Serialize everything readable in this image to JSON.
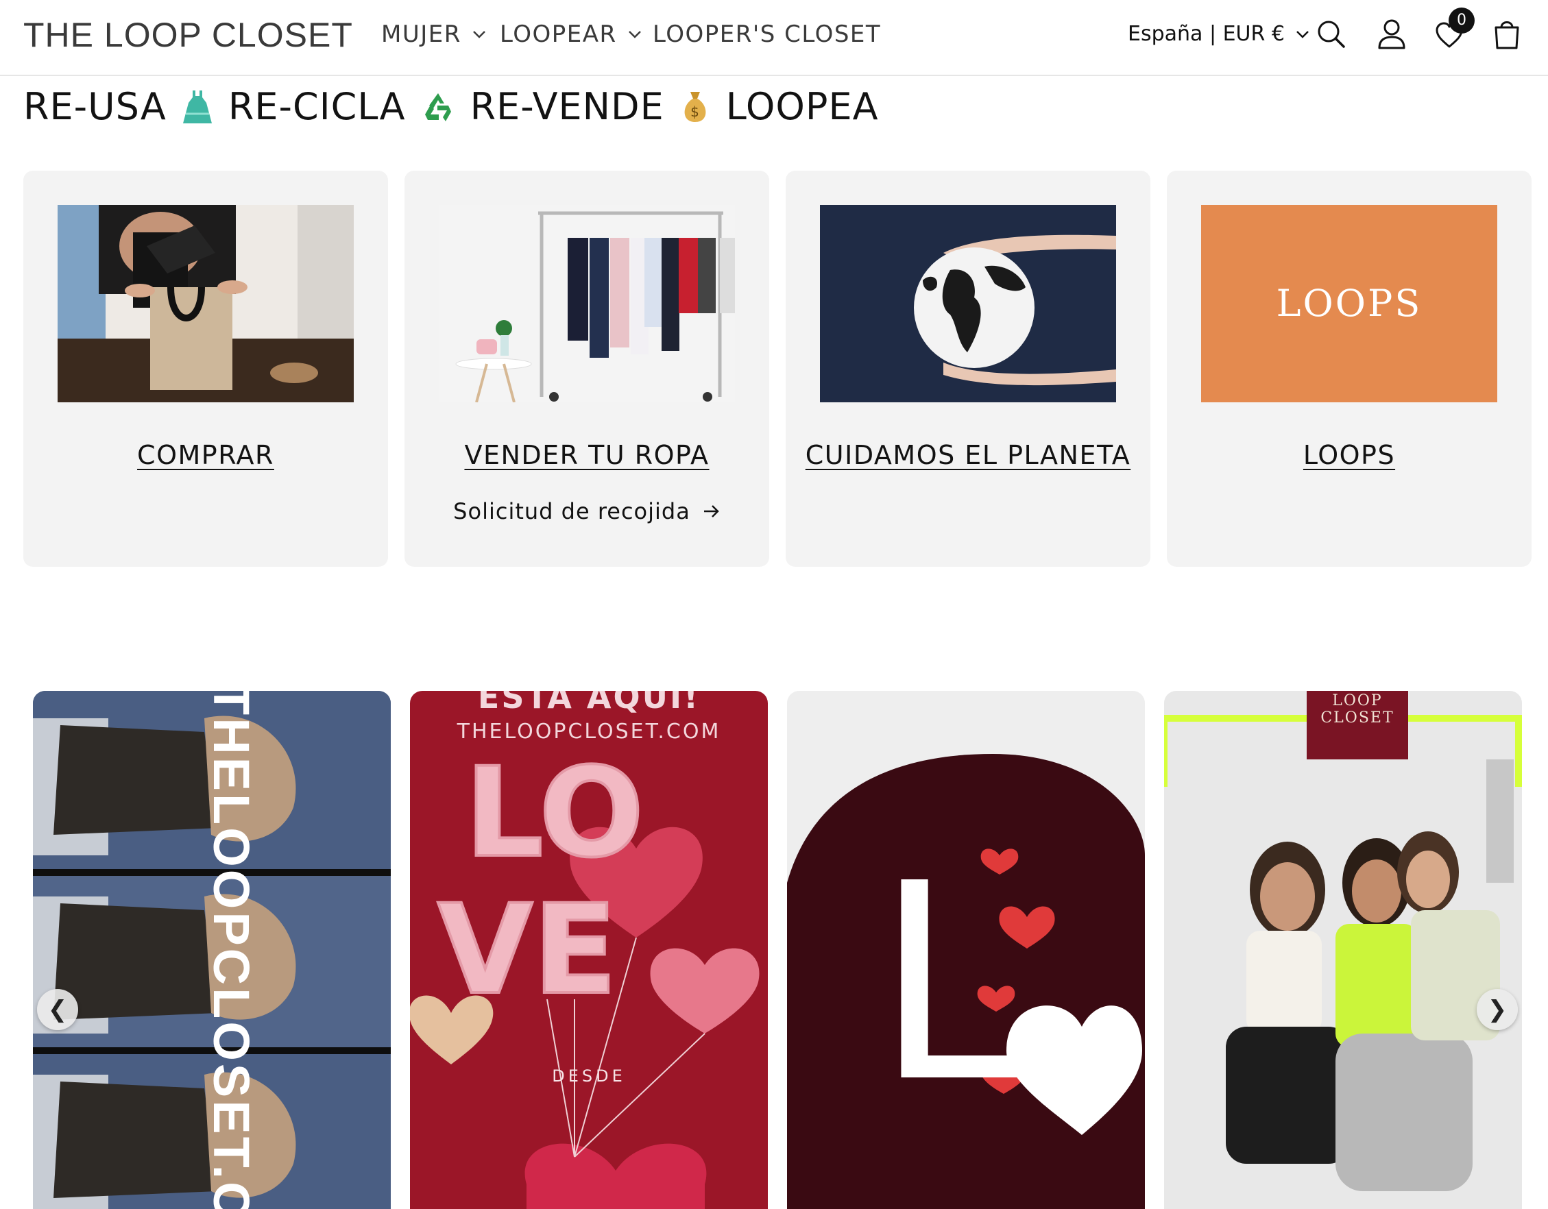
{
  "header": {
    "logo": "THE LOOP CLOSET",
    "nav": [
      {
        "label": "MUJER",
        "dropdown": true
      },
      {
        "label": "LOOPEAR",
        "dropdown": true
      },
      {
        "label": "LOOPER'S CLOSET",
        "dropdown": false
      }
    ],
    "locale": "España | EUR €",
    "wishlist_count": "0",
    "icons": [
      "search-icon",
      "account-icon",
      "heart-icon",
      "cart-icon"
    ]
  },
  "headline": {
    "parts": [
      "RE-USA",
      "RE-CICLA",
      "RE-VENDE",
      "LOOPEA"
    ],
    "emojis": [
      "dress-emoji",
      "recycle-emoji",
      "money-bag-emoji"
    ]
  },
  "cards": [
    {
      "title": "COMPRAR",
      "link": ""
    },
    {
      "title": "VENDER TU ROPA",
      "link": "Solicitud de recojida"
    },
    {
      "title": "CUIDAMOS EL PLANETA",
      "link": ""
    },
    {
      "title": "LOOPS",
      "link": "",
      "image_text": "LOOPS"
    }
  ],
  "carousel": {
    "prev": "❮",
    "next": "❯",
    "slides": [
      {
        "text": "THELOOPCLOSET.C"
      },
      {
        "top_text": "ESTA AQUI!",
        "url_text": "THELOOPCLOSET.COM",
        "balloon_text": "DESDE"
      },
      {
        "letter": "L"
      },
      {
        "logo_line1": "LOOP",
        "logo_line2": "CLOSET"
      }
    ]
  },
  "colors": {
    "text": "#121212",
    "card_bg": "#f3f3f3",
    "loops_orange": "#e48a4f",
    "valentine_red": "#9b1628",
    "dark_maroon": "#3a0a12"
  }
}
